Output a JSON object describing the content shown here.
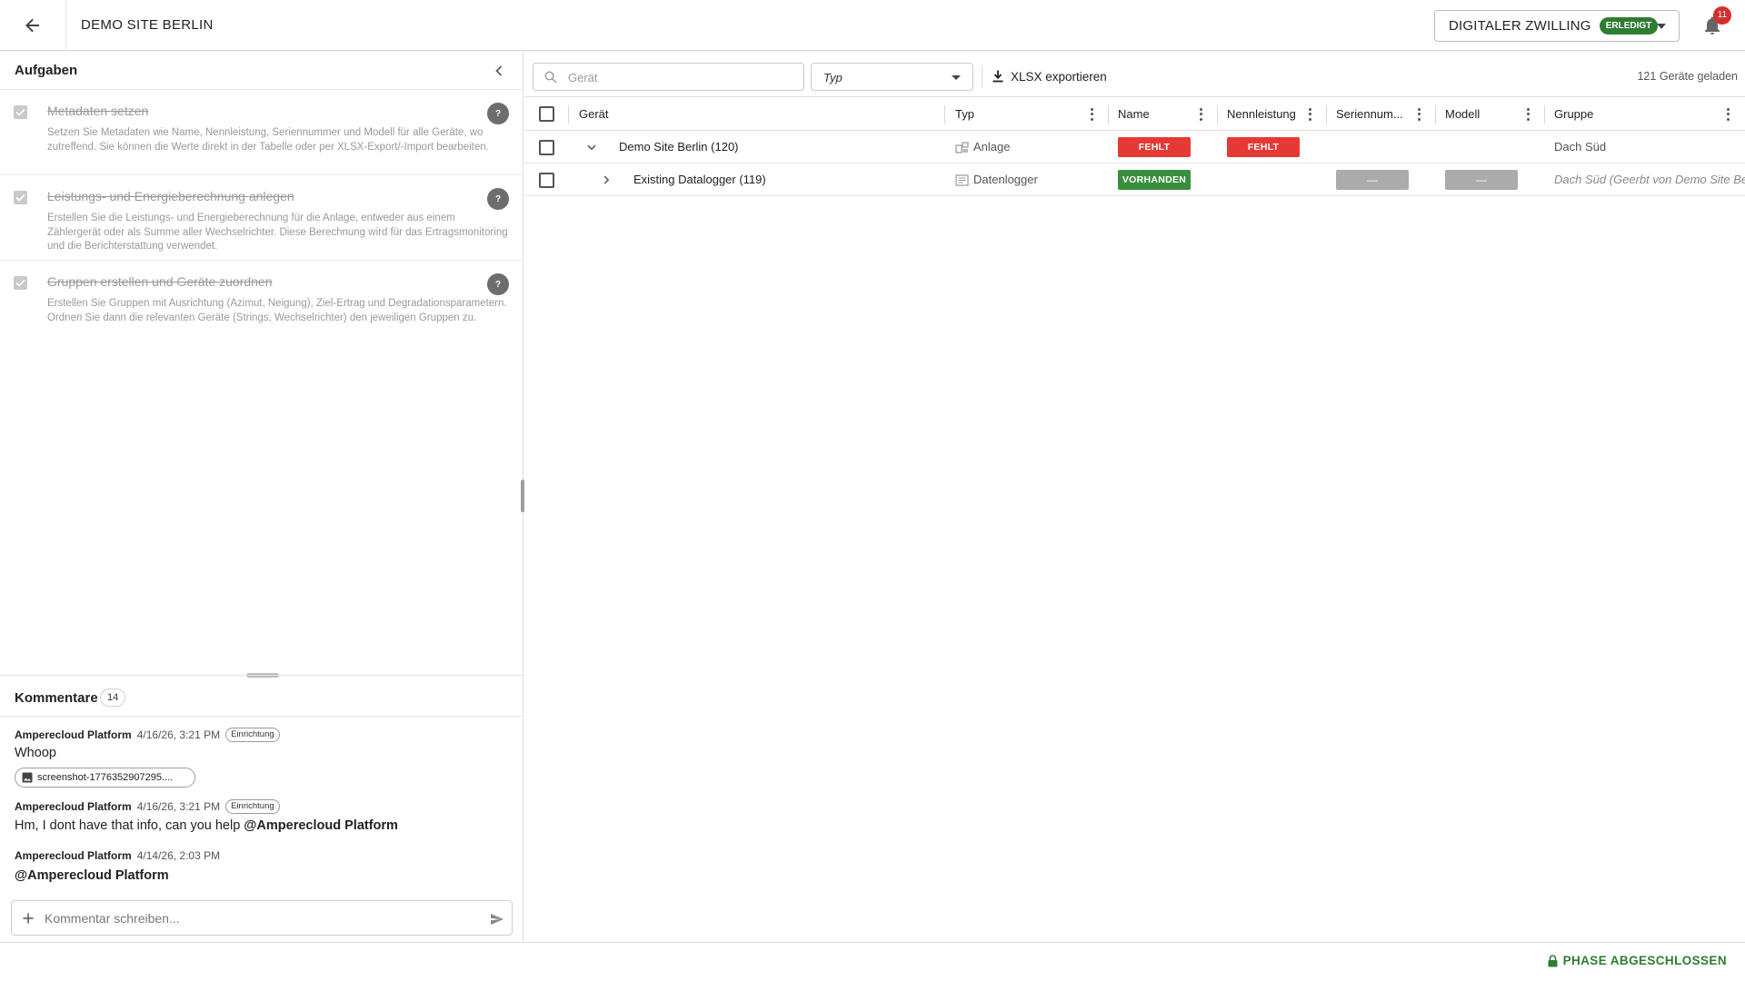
{
  "header": {
    "title": "DEMO SITE BERLIN",
    "phase_label": "DIGITALER ZWILLING",
    "phase_badge": "ERLEDIGT",
    "notification_count": "11"
  },
  "tasks": {
    "title": "Aufgaben",
    "items": [
      {
        "title": "Metadaten setzen",
        "description": "Setzen Sie Metadaten wie Name, Nennleistung, Seriennummer und Modell für alle Geräte, wo zutreffend. Sie können die Werte direkt in der Tabelle oder per XLSX-Export/-Import bearbeiten.",
        "help": "?",
        "done": true
      },
      {
        "title": "Leistungs- und Energieberechnung anlegen",
        "description": "Erstellen Sie die Leistungs- und Energieberechnung für die Anlage, entweder aus einem Zählergerät oder als Summe aller Wechselrichter. Diese Berechnung wird für das Ertragsmonitoring und die Berichterstattung verwendet.",
        "help": "?",
        "done": true
      },
      {
        "title": "Gruppen erstellen und Geräte zuordnen",
        "description": "Erstellen Sie Gruppen mit Ausrichtung (Azimut, Neigung), Ziel-Ertrag und Degradationsparametern. Ordnen Sie dann die relevanten Geräte (Strings, Wechselrichter) den jeweiligen Gruppen zu.",
        "help": "?",
        "done": true
      }
    ]
  },
  "comments": {
    "title": "Kommentare",
    "count": "14",
    "items": [
      {
        "author": "Amperecloud Platform",
        "time": "4/16/26, 3:21 PM",
        "tag": "Einrichtung",
        "text": "Whoop",
        "attachment": "screenshot-1776352907295...."
      },
      {
        "author": "Amperecloud Platform",
        "time": "4/16/26, 3:21 PM",
        "tag": "Einrichtung",
        "text": "Hm, I dont have that info, can you help ",
        "mention": "@Amperecloud Platform"
      },
      {
        "author": "Amperecloud Platform",
        "time": "4/14/26, 2:03 PM",
        "mention": "@Amperecloud Platform"
      }
    ],
    "input_placeholder": "Kommentar schreiben..."
  },
  "toolbar": {
    "search_placeholder": "Gerät",
    "type_filter": "Typ",
    "export_label": "XLSX exportieren",
    "loaded_count": "121 Geräte geladen"
  },
  "grid": {
    "columns": [
      "Gerät",
      "Typ",
      "Name",
      "Nennleistung",
      "Seriennum...",
      "Modell",
      "Gruppe"
    ],
    "rows": [
      {
        "device": "Demo Site Berlin (120)",
        "type": "Anlage",
        "type_icon": "plant-icon",
        "name_status": "FEHLT",
        "power_status": "FEHLT",
        "serial": "",
        "model": "",
        "group": "Dach Süd",
        "expanded": true
      },
      {
        "device": "Existing Datalogger (119)",
        "type": "Datenlogger",
        "type_icon": "datalogger-icon",
        "name_status": "VORHANDEN",
        "power_status": "",
        "serial": "—",
        "model": "—",
        "group": "Dach Süd (Geerbt von Demo Site Berlin)",
        "expanded": false
      }
    ]
  },
  "footer": {
    "phase_closed": "PHASE ABGESCHLOSSEN"
  },
  "colors": {
    "missing": "#e53935",
    "present": "#388e3c",
    "done_badge": "#2e7d32",
    "empty_chip": "#ababab"
  }
}
